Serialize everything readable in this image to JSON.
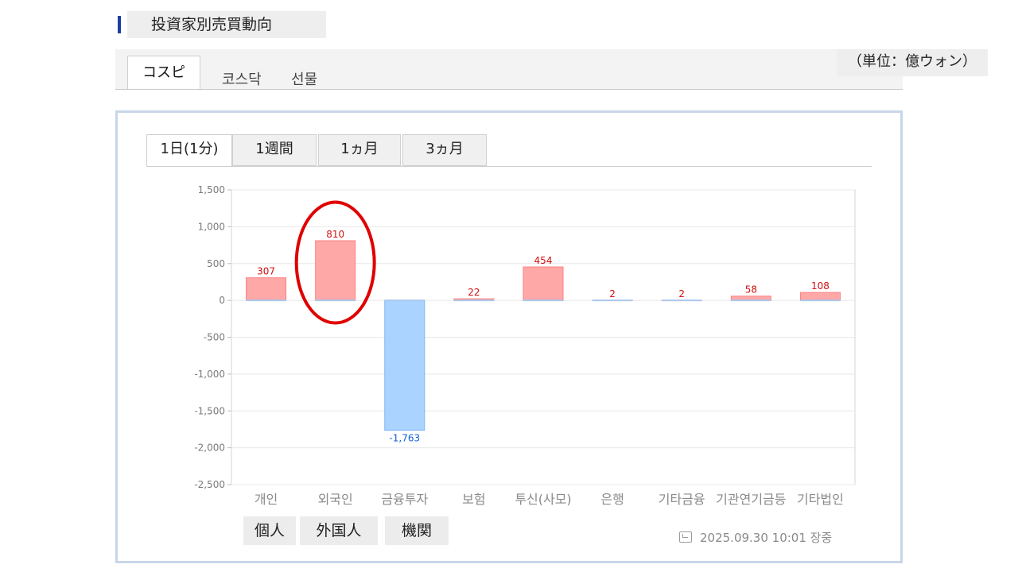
{
  "header": {
    "title": "投資家別売買動向"
  },
  "market_tabs": [
    {
      "label": "コスピ",
      "active": true
    },
    {
      "label": "코스닥",
      "active": false
    },
    {
      "label": "선물",
      "active": false
    }
  ],
  "unit": "（単位：億ウォン）",
  "period_tabs": [
    {
      "label": "1日(1分)",
      "active": true
    },
    {
      "label": "1週間",
      "active": false
    },
    {
      "label": "1ヵ月",
      "active": false
    },
    {
      "label": "3ヵ月",
      "active": false
    }
  ],
  "chart_data": {
    "type": "bar",
    "categories": [
      "개인",
      "외국인",
      "금융투자",
      "보험",
      "투신(사모)",
      "은행",
      "기타금융",
      "기관연기금등",
      "기타법인"
    ],
    "values": [
      307,
      810,
      -1763,
      22,
      454,
      2,
      2,
      58,
      108
    ],
    "data_labels": [
      "307",
      "810",
      "-1,763",
      "22",
      "454",
      "2",
      "2",
      "58",
      "108"
    ],
    "ylim": [
      -2500,
      1500
    ],
    "yticks": [
      1500,
      1000,
      500,
      0,
      -500,
      -1000,
      -1500,
      -2000,
      -2500
    ],
    "ytick_labels": [
      "1,500",
      "1,000",
      "500",
      "0",
      "-500",
      "-1,000",
      "-1,500",
      "-2,000",
      "-2,500"
    ],
    "grid": "horizontal",
    "colors": {
      "positive_fill": "#ffa8a8",
      "positive_stroke": "#ff8080",
      "negative_fill": "#aad4ff",
      "negative_stroke": "#7fb3f0",
      "highlight": "#e00000"
    },
    "highlight_category": "외국인"
  },
  "group_tags": [
    "個人",
    "外国人",
    "機関"
  ],
  "timestamp": "2025.09.30 10:01 장중",
  "icons": {
    "timestamp": "clock-icon"
  }
}
